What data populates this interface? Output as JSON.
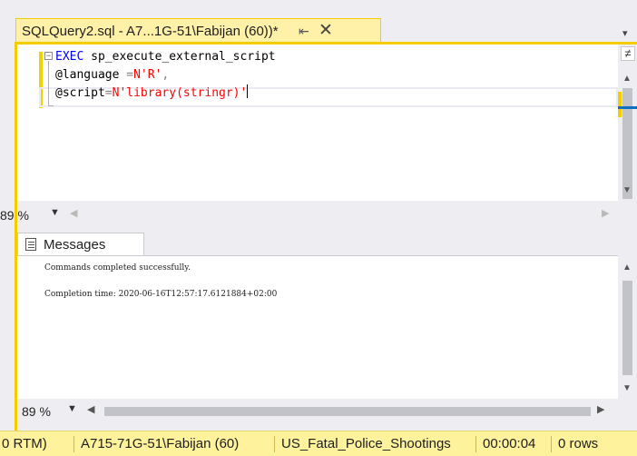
{
  "tab": {
    "title": "SQLQuery2.sql - A7...1G-51\\Fabijan (60))*",
    "pin_glyph": "⇤",
    "close_glyph": "✕",
    "overflow_glyph": "▾"
  },
  "editor": {
    "outline_glyph": "−",
    "lines": [
      {
        "kw": "EXEC",
        "rest": " sp_execute_external_script"
      },
      {
        "param": "@language",
        "op": " =",
        "str": "N'R'",
        "tail": ","
      },
      {
        "param": "@script",
        "op": "=",
        "str": "N'library(stringr)'",
        "tail": ""
      }
    ],
    "zoom": "89 %"
  },
  "editor_scrollbar": {
    "split_glyph": "≠",
    "up_glyph": "▲",
    "down_glyph": "▼"
  },
  "results": {
    "tab_label": "Messages",
    "messages": [
      "Commands completed successfully.",
      "Completion time: 2020-06-16T12:57:17.6121884+02:00"
    ],
    "zoom": "89 %"
  },
  "glyphs": {
    "dropdown": "▼",
    "left": "◀",
    "right": "▶",
    "up": "▲",
    "down": "▼"
  },
  "statusbar": {
    "items": [
      "0 RTM)",
      "A715-71G-51\\Fabijan (60)",
      "US_Fatal_Police_Shootings",
      "00:00:04",
      "0 rows"
    ]
  },
  "colors": {
    "accent_yellow": "#f5cc00",
    "status_bg": "#fff29d",
    "keyword": "#0000ff",
    "string": "#ff0000"
  }
}
